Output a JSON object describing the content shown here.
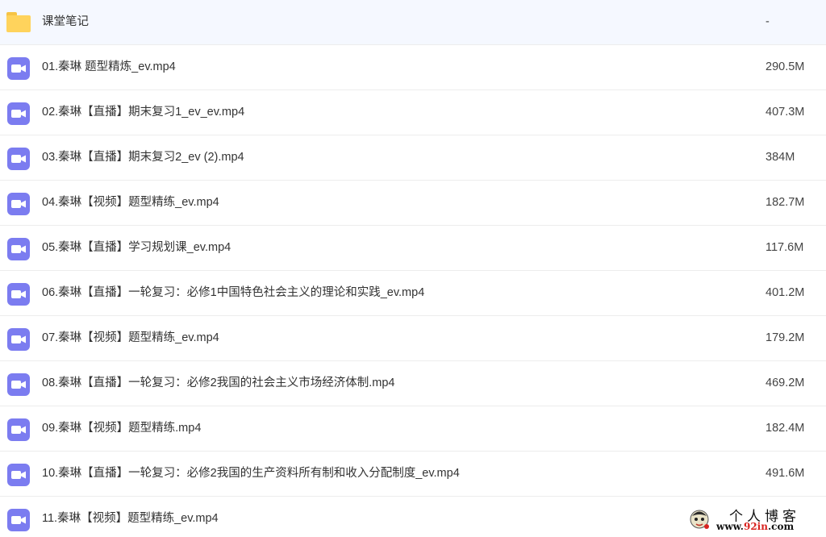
{
  "icons": {
    "folder": "folder-icon",
    "video": "video-file-icon"
  },
  "colors": {
    "video_icon": "#7b7cf0",
    "folder": "#ffd35c",
    "folder_tab": "#f6c445",
    "row_border": "#ededed",
    "watermark_accent": "#d8231f"
  },
  "files": [
    {
      "name": "课堂笔记",
      "size": "-",
      "type": "folder"
    },
    {
      "name": "01.秦琳 题型精炼_ev.mp4",
      "size": "290.5M",
      "type": "video"
    },
    {
      "name": "02.秦琳【直播】期末复习1_ev_ev.mp4",
      "size": "407.3M",
      "type": "video"
    },
    {
      "name": "03.秦琳【直播】期末复习2_ev (2).mp4",
      "size": "384M",
      "type": "video"
    },
    {
      "name": "04.秦琳【视频】题型精练_ev.mp4",
      "size": "182.7M",
      "type": "video"
    },
    {
      "name": "05.秦琳【直播】学习规划课_ev.mp4",
      "size": "117.6M",
      "type": "video"
    },
    {
      "name": "06.秦琳【直播】一轮复习：必修1中国特色社会主义的理论和实践_ev.mp4",
      "size": "401.2M",
      "type": "video"
    },
    {
      "name": "07.秦琳【视频】题型精练_ev.mp4",
      "size": "179.2M",
      "type": "video"
    },
    {
      "name": "08.秦琳【直播】一轮复习：必修2我国的社会主义市场经济体制.mp4",
      "size": "469.2M",
      "type": "video"
    },
    {
      "name": "09.秦琳【视频】题型精练.mp4",
      "size": "182.4M",
      "type": "video"
    },
    {
      "name": "10.秦琳【直播】一轮复习：必修2我国的生产资料所有制和收入分配制度_ev.mp4",
      "size": "491.6M",
      "type": "video"
    },
    {
      "name": "11.秦琳【视频】题型精练_ev.mp4",
      "size": "",
      "type": "video"
    }
  ],
  "watermark": {
    "title": "个人博客",
    "url_prefix": "www.",
    "url_highlight": "92in",
    "url_suffix": ".com"
  }
}
